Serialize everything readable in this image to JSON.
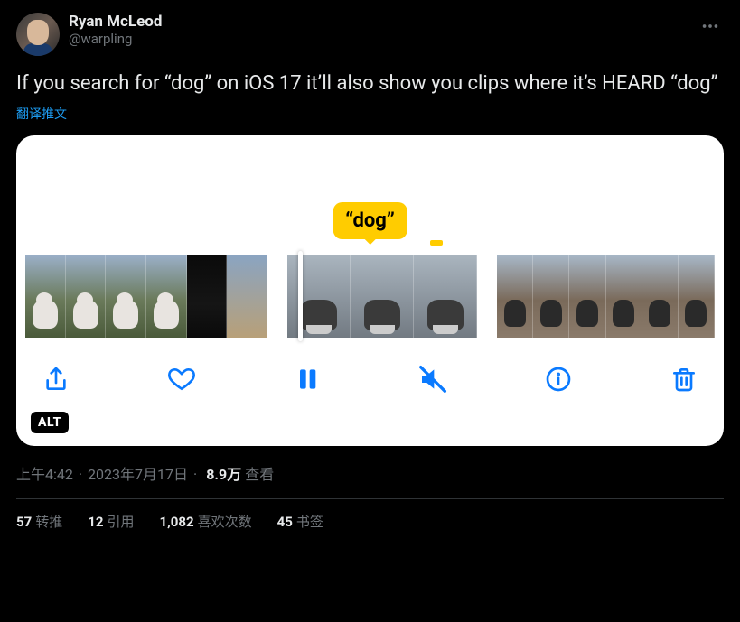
{
  "author": {
    "display_name": "Ryan McLeod",
    "handle": "@warpling"
  },
  "tweet_text": "If you search for “dog” on iOS 17 it’ll also show you clips where it’s HEARD “dog”",
  "translate_label": "翻译推文",
  "media": {
    "tooltip_text": "“dog”",
    "alt_badge": "ALT",
    "toolbar_icons": [
      "share-icon",
      "heart-icon",
      "pause-icon",
      "mute-icon",
      "info-icon",
      "trash-icon"
    ]
  },
  "meta": {
    "time": "上午4:42",
    "date": "2023年7月17日",
    "views_count": "8.9万",
    "views_label": "查看"
  },
  "stats": {
    "retweets": {
      "count": "57",
      "label": "转推"
    },
    "quotes": {
      "count": "12",
      "label": "引用"
    },
    "likes": {
      "count": "1,082",
      "label": "喜欢次数"
    },
    "bookmarks": {
      "count": "45",
      "label": "书签"
    }
  }
}
